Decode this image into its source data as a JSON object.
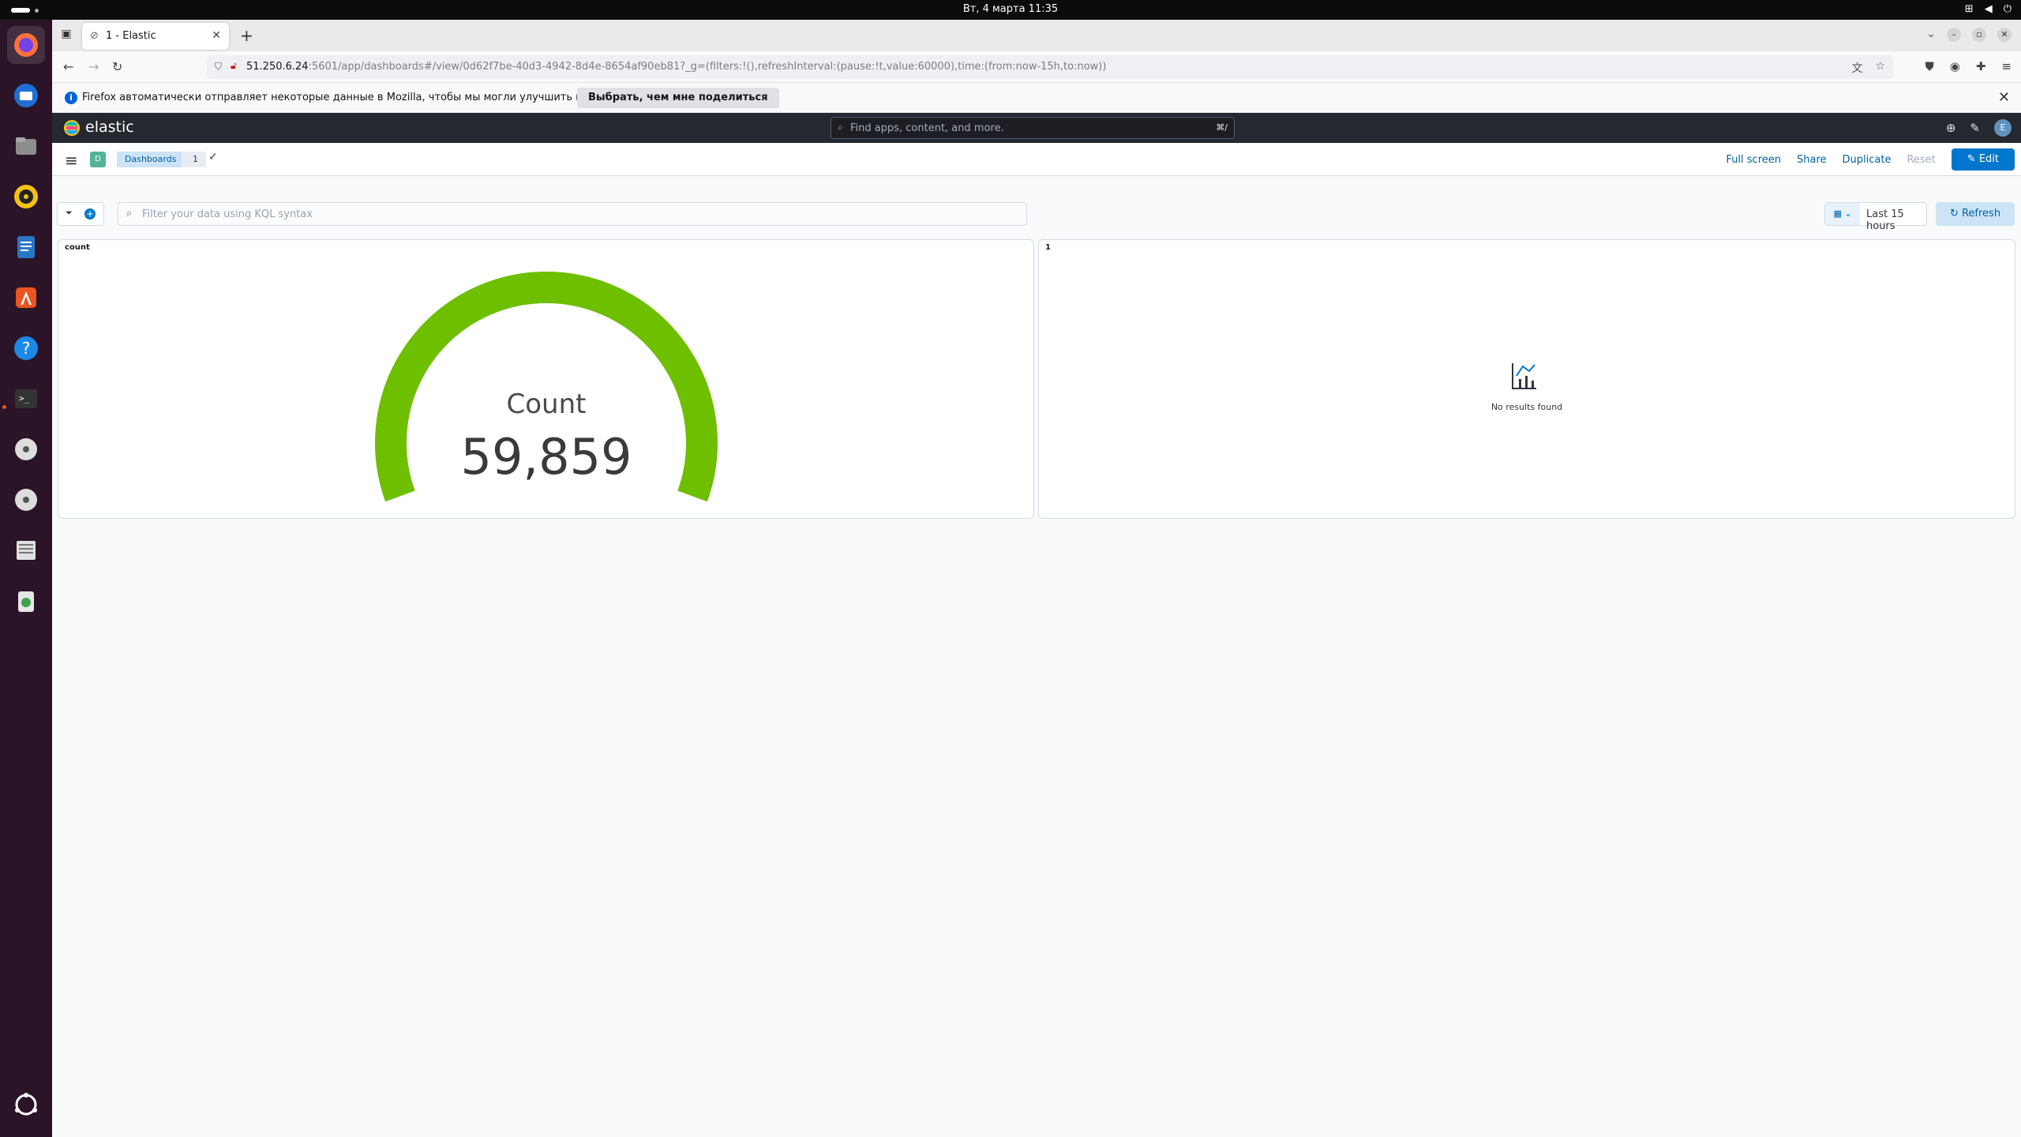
{
  "os": {
    "clock": "Вт, 4 марта  11:35"
  },
  "browser": {
    "tab_title": "1 - Elastic",
    "url_host": "51.250.6.24",
    "url_path": ":5601/app/dashboards#/view/0d62f7be-40d3-4942-8d4e-8654af90eb81?_g=(filters:!(),refreshInterval:(pause:!t,value:60000),time:(from:now-15h,to:now))",
    "notification_text": "Firefox автоматически отправляет некоторые данные в Mozilla, чтобы мы могли улучшить ваш браузер.",
    "notification_button": "Выбрать, чем мне поделиться"
  },
  "kibana": {
    "logo_text": "elastic",
    "search_placeholder": "Find apps, content, and more.",
    "search_shortcut": "⌘/",
    "avatar_letter": "E",
    "space_letter": "D",
    "breadcrumbs": [
      "Dashboards",
      "1"
    ],
    "actions": {
      "full_screen": "Full screen",
      "share": "Share",
      "duplicate": "Duplicate",
      "reset": "Reset",
      "edit": "Edit"
    },
    "query_placeholder": "Filter your data using KQL syntax",
    "time_range": "Last 15 hours",
    "refresh_label": "Refresh"
  },
  "panels": {
    "count": {
      "title": "count",
      "gauge_label": "Count",
      "gauge_value": "59,859",
      "fill_fraction": 1.0,
      "color": "#6dbf00"
    },
    "empty": {
      "title": "1",
      "message": "No results found"
    }
  },
  "colors": {
    "accent": "#0077cc",
    "gauge": "#6dbf00",
    "kibana_header": "#25282f"
  }
}
